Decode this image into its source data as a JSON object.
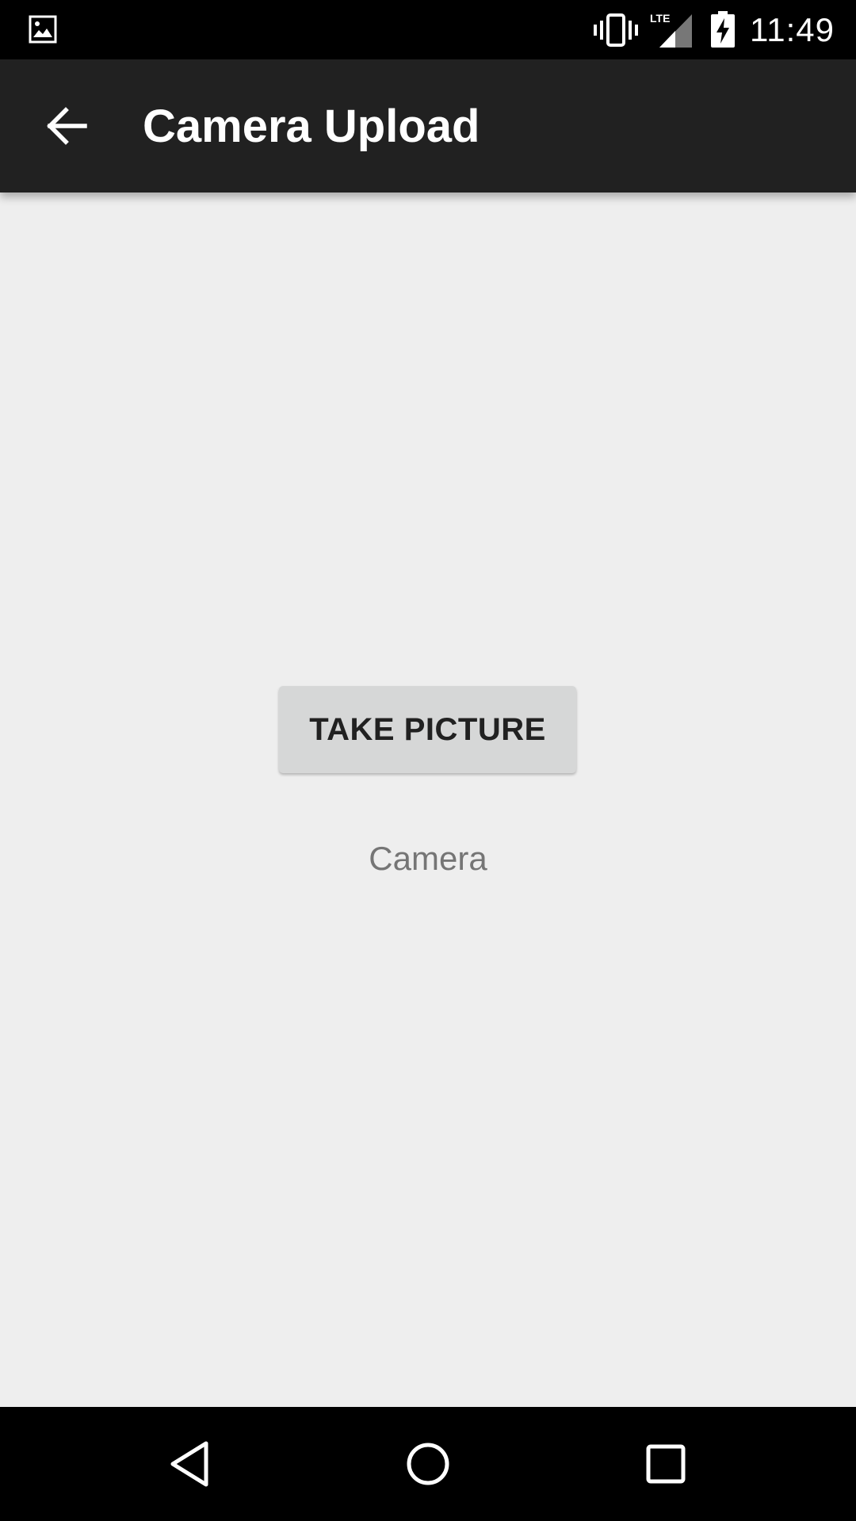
{
  "status_bar": {
    "time": "11:49",
    "network": "LTE",
    "icons": [
      "gallery-icon",
      "vibrate-icon",
      "lte-signal-icon",
      "battery-charging-icon"
    ]
  },
  "app_bar": {
    "title": "Camera Upload",
    "back_icon": "arrow-back-icon"
  },
  "main": {
    "take_picture_label": "TAKE PICTURE",
    "camera_label": "Camera"
  },
  "nav_bar": {
    "icons": [
      "nav-back-icon",
      "nav-home-icon",
      "nav-recents-icon"
    ]
  },
  "colors": {
    "status_bar": "#000000",
    "app_bar": "#212121",
    "background": "#eeeeee",
    "button": "#d6d7d7",
    "button_text": "#212121",
    "secondary_text": "#757575"
  }
}
